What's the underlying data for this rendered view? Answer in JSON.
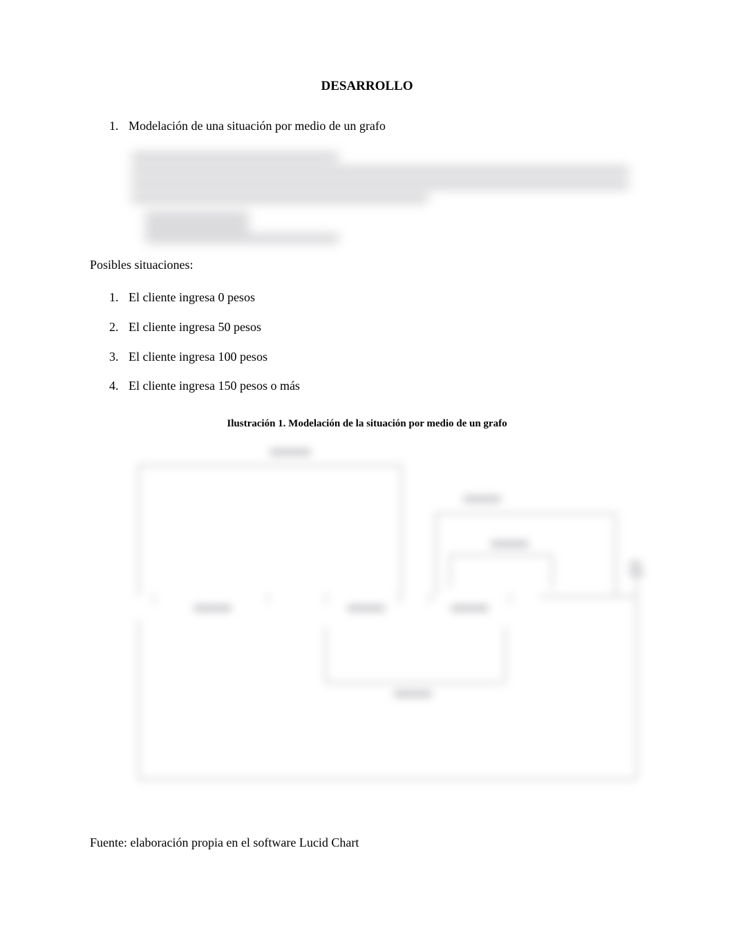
{
  "title": "DESARROLLO",
  "section1": {
    "number": "1.",
    "text": "Modelación de una situación por medio de un grafo"
  },
  "subheading": "Posibles situaciones:",
  "situations": [
    {
      "number": "1.",
      "text": "El cliente ingresa 0 pesos"
    },
    {
      "number": "2.",
      "text": "El cliente ingresa 50 pesos"
    },
    {
      "number": "3.",
      "text": "El cliente ingresa 100 pesos"
    },
    {
      "number": "4.",
      "text": "El cliente ingresa 150 pesos o más"
    }
  ],
  "illustration_caption": "Ilustración 1. Modelación de la situación por medio de un grafo",
  "source": "Fuente: elaboración propia en el software Lucid Chart"
}
